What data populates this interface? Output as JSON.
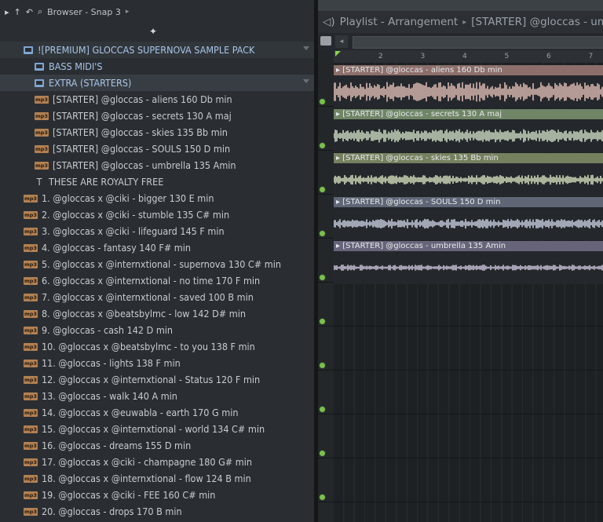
{
  "browser": {
    "title": "Browser - Snap 3",
    "header_icons": [
      "arrow-up-icon",
      "undo-icon",
      "search-icon"
    ],
    "snap_icon": "snap-magnet-icon",
    "folders": [
      {
        "label": "![PREMIUM] GLOCCAS SUPERNOVA SAMPLE PACK"
      },
      {
        "label": "BASS MIDI'S"
      },
      {
        "label": "EXTRA (STARTERS)"
      }
    ],
    "starters": [
      "[STARTER] @gloccas - aliens 160 Db min",
      "[STARTER] @gloccas - secrets 130 A maj",
      "[STARTER] @gloccas - skies 135 Bb min",
      "[STARTER] @gloccas - SOULS 150 D min",
      "[STARTER] @gloccas - umbrella 135 Amin"
    ],
    "note": "THESE ARE ROYALTY FREE",
    "samples": [
      "1. @gloccas x @ciki - bigger 130 E min",
      "2. @gloccas x @ciki - stumble 135 C# min",
      "3. @gloccas x @ciki - lifeguard 145 F min",
      "4. @gloccas - fantasy 140 F# min",
      "5. @gloccas x @internxtional - supernova 130 C# min",
      "6. @gloccas x @internxtional - no time 170 F min",
      "7. @gloccas x @internxtional - saved 100 B min",
      "8. @gloccas x @beatsbylmc - low 142 D# min",
      "9. @gloccas - cash 142 D min",
      "10. @gloccas x @beatsbylmc - to you 138 F min",
      "11. @gloccas - lights 138 F min",
      "12. @gloccas x @internxtional - Status 120 F min",
      "13. @gloccas - walk 140 A min",
      "14. @gloccas x @euwabla - earth 170 G min",
      "15. @gloccas x @internxtional - world 134 C# min",
      "16. @gloccas - dreams 155 D min",
      "17. @gloccas x @ciki - champagne 180 G# min",
      "18. @gloccas x @internxtional - flow 124 B min",
      "19. @gloccas x @ciki - FEE 160 C# min",
      "20. @gloccas - drops 170 B min"
    ],
    "mp3_badge": "mp3"
  },
  "playlist": {
    "title": "Playlist - Arrangement",
    "separator": "▸",
    "current_clip": "[STARTER] @gloccas - umbrell",
    "ruler": [
      "2",
      "3",
      "4",
      "5",
      "6",
      "7"
    ],
    "clips": [
      {
        "label": "[STARTER] @gloccas - aliens 160 Db min",
        "color": "#8c6f6b",
        "wave": "#d8b8b0"
      },
      {
        "label": "[STARTER] @gloccas - secrets 130 A maj",
        "color": "#6f8566",
        "wave": "#c8d6be"
      },
      {
        "label": "[STARTER] @gloccas - skies 135 Bb min",
        "color": "#75805f",
        "wave": "#cfd8b8"
      },
      {
        "label": "[STARTER] @gloccas - SOULS 150 D min",
        "color": "#5f6676",
        "wave": "#c2c7d8"
      },
      {
        "label": "[STARTER] @gloccas - umbrella 135 Amin",
        "color": "#67647a",
        "wave": "#c6c0d6"
      }
    ]
  }
}
